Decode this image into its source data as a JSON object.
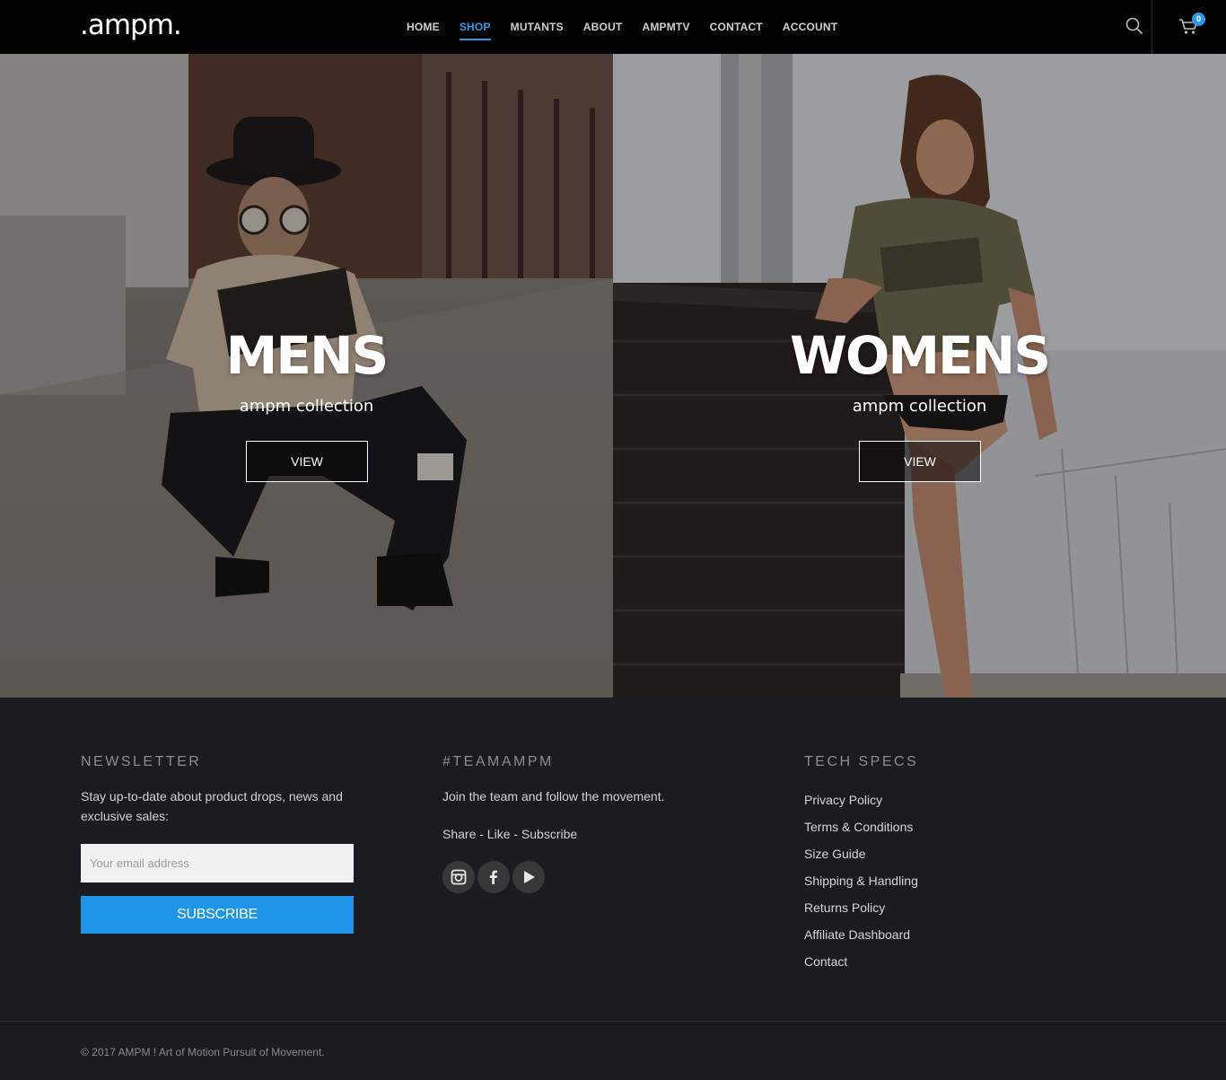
{
  "header": {
    "logo": ".ampm.",
    "nav": [
      {
        "label": "HOME",
        "active": false
      },
      {
        "label": "SHOP",
        "active": true
      },
      {
        "label": "MUTANTS",
        "active": false
      },
      {
        "label": "ABOUT",
        "active": false
      },
      {
        "label": "AMPMTV",
        "active": false
      },
      {
        "label": "CONTACT",
        "active": false
      },
      {
        "label": "ACCOUNT",
        "active": false
      }
    ],
    "search_icon": "search-icon",
    "cart_icon": "cart-icon",
    "cart_count": "0"
  },
  "hero": {
    "mens": {
      "title": "MENS",
      "subtitle": "ampm collection",
      "button": "VIEW"
    },
    "womens": {
      "title": "WOMENS",
      "subtitle": "ampm collection",
      "button": "VIEW"
    }
  },
  "footer": {
    "newsletter": {
      "title": "NEWSLETTER",
      "text": "Stay up-to-date about product drops, news and exclusive sales:",
      "email_placeholder": "Your email address",
      "subscribe_label": "SUBSCRIBE"
    },
    "team": {
      "title": "#TEAMAMPM",
      "text": "Join the team and follow the movement.",
      "share_text": "Share - Like - Subscribe",
      "socials": [
        "instagram-icon",
        "facebook-icon",
        "youtube-icon"
      ]
    },
    "tech_specs": {
      "title": "TECH SPECS",
      "links": [
        "Privacy Policy",
        "Terms & Conditions",
        "Size Guide",
        "Shipping & Handling",
        "Returns Policy",
        "Affiliate Dashboard",
        "Contact"
      ]
    },
    "copyright": "© 2017 AMPM ! Art of Motion Pursuit of Movement."
  },
  "colors": {
    "accent": "#2f97e6",
    "header_bg": "#030303",
    "footer_bg": "#1b1c1f",
    "subscribe_bg": "#1f95e7"
  }
}
